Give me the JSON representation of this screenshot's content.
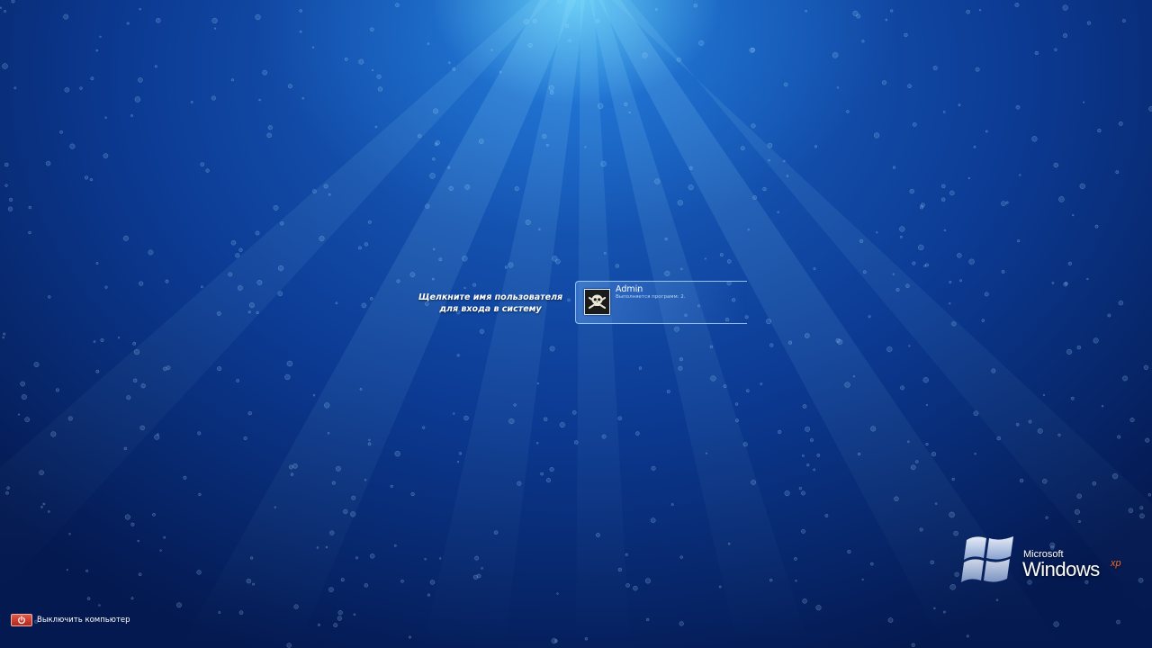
{
  "login": {
    "prompt_line1": "Щелкните имя пользователя",
    "prompt_line2": "для входа в систему"
  },
  "user": {
    "name": "Admin",
    "status": "Выполняется программ: 2."
  },
  "branding": {
    "company": "Microsoft",
    "product": "Windows",
    "edition": "xp"
  },
  "footer": {
    "shutdown_label": "Выключить компьютер"
  },
  "icons": {
    "avatar": "skull-crossbones-icon",
    "shutdown": "power-icon",
    "logo": "windows-flag-icon"
  },
  "colors": {
    "background": "#0a2a78",
    "light_glow": "#6edcff",
    "tile_border": "#aad7ff",
    "shutdown_red": "#c8372a",
    "xp_orange": "#f26a2e"
  }
}
